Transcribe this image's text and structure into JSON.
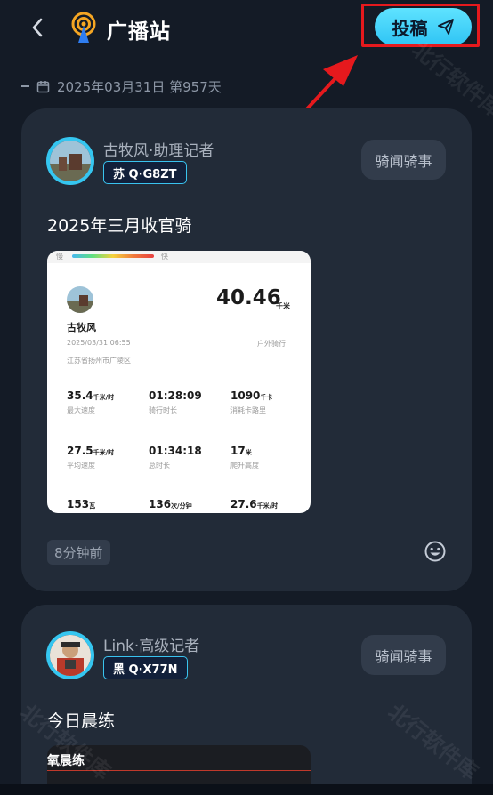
{
  "header": {
    "title": "广播站",
    "submit_label": "投稿"
  },
  "date_row": {
    "text": "2025年03月31日  第957天"
  },
  "posts": [
    {
      "author": "古牧风·助理记者",
      "plate": "苏 Q·G8ZT",
      "category": "骑闻骑事",
      "title": "2025年三月收官骑",
      "time": "8分钟前",
      "screenshot": {
        "slow": "慢",
        "fast": "快",
        "rider": "古牧风",
        "datetime": "2025/03/31 06:55",
        "location": "江苏省扬州市广陵区",
        "distance": "40.46",
        "distance_unit": "千米",
        "ride_type": "户外骑行",
        "stats": [
          {
            "value": "35.4",
            "unit": "千米/时",
            "label": "最大速度"
          },
          {
            "value": "01:28:09",
            "unit": "",
            "label": "骑行时长"
          },
          {
            "value": "1090",
            "unit": "千卡",
            "label": "消耗卡路里"
          },
          {
            "value": "27.5",
            "unit": "千米/时",
            "label": "平均速度"
          },
          {
            "value": "01:34:18",
            "unit": "",
            "label": "总时长"
          },
          {
            "value": "17",
            "unit": "米",
            "label": "爬升高度"
          },
          {
            "value": "153",
            "unit": "瓦",
            "label": ""
          },
          {
            "value": "136",
            "unit": "次/分钟",
            "label": ""
          },
          {
            "value": "27.6",
            "unit": "千米/时",
            "label": ""
          }
        ]
      }
    },
    {
      "author": "Link·高级记者",
      "plate": "黑 Q·X77N",
      "category": "骑闻骑事",
      "title": "今日晨练",
      "thumb_text": "氧晨练"
    }
  ],
  "watermark": "北行软件库",
  "colors": {
    "accent": "#35c6f0",
    "background": "#141b26",
    "card": "#222b38",
    "annotation": "#e5191d"
  },
  "icons": [
    "back-chevron-icon",
    "broadcast-logo-icon",
    "send-plane-icon",
    "calendar-icon",
    "emoji-icon"
  ]
}
